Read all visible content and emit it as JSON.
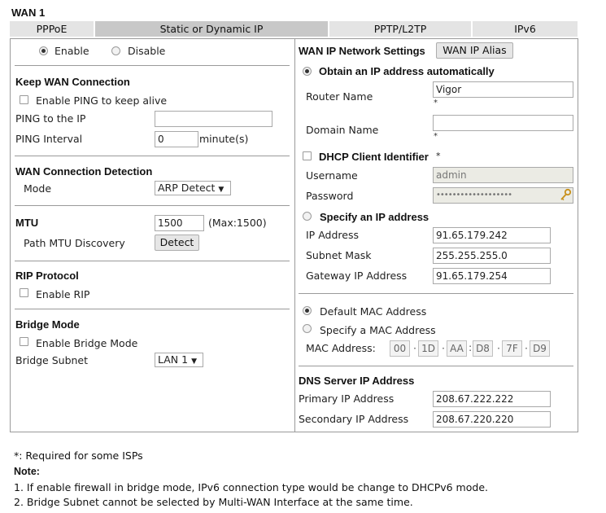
{
  "section_title": "WAN 1",
  "tabs": [
    "PPPoE",
    "Static or Dynamic IP",
    "PPTP/L2TP",
    "IPv6"
  ],
  "left": {
    "enable_label": "Enable",
    "disable_label": "Disable",
    "keep_wan_title": "Keep WAN Connection",
    "enable_ping_label": "Enable PING to keep alive",
    "ping_to_ip_label": "PING to the IP",
    "ping_to_ip_value": "",
    "ping_interval_label": "PING Interval",
    "ping_interval_value": "0",
    "ping_interval_unit": "minute(s)",
    "wan_detection_title": "WAN Connection Detection",
    "mode_label": "Mode",
    "mode_value": "ARP Detect",
    "mtu_title": "MTU",
    "mtu_value": "1500",
    "mtu_max": "(Max:1500)",
    "path_mtu_label": "Path MTU Discovery",
    "detect_button": "Detect",
    "rip_title": "RIP Protocol",
    "enable_rip_label": "Enable RIP",
    "bridge_title": "Bridge Mode",
    "enable_bridge_label": "Enable Bridge Mode",
    "bridge_subnet_label": "Bridge Subnet",
    "bridge_subnet_value": "LAN 1"
  },
  "right": {
    "network_settings_title": "WAN IP Network Settings",
    "wan_ip_alias_button": "WAN IP Alias",
    "obtain_auto_label": "Obtain an IP address automatically",
    "router_name_label": "Router Name",
    "router_name_value": "Vigor",
    "domain_name_label": "Domain Name",
    "domain_name_value": "",
    "star": "*",
    "dhcp_client_label": "DHCP Client Identifier",
    "username_label": "Username",
    "username_value": "admin",
    "password_label": "Password",
    "password_value": "•••••••••••••••••••",
    "specify_ip_label": "Specify an IP address",
    "ip_address_label": "IP Address",
    "ip_address_value": "91.65.179.242",
    "subnet_mask_label": "Subnet Mask",
    "subnet_mask_value": "255.255.255.0",
    "gateway_label": "Gateway IP Address",
    "gateway_value": "91.65.179.254",
    "default_mac_label": "Default MAC Address",
    "specify_mac_label": "Specify a MAC Address",
    "mac_address_label": "MAC Address:",
    "mac": [
      "00",
      "1D",
      "AA",
      "D8",
      "7F",
      "D9"
    ],
    "dns_title": "DNS Server IP Address",
    "primary_dns_label": "Primary IP Address",
    "primary_dns_value": "208.67.222.222",
    "secondary_dns_label": "Secondary IP Address",
    "secondary_dns_value": "208.67.220.220"
  },
  "footer": {
    "required_note": "*: Required for some ISPs",
    "note_title": "Note:",
    "note1": "1. If enable firewall in bridge mode, IPv6 connection type would be change to DHCPv6 mode.",
    "note2": "2. Bridge Subnet cannot be selected by Multi-WAN Interface at the same time."
  }
}
